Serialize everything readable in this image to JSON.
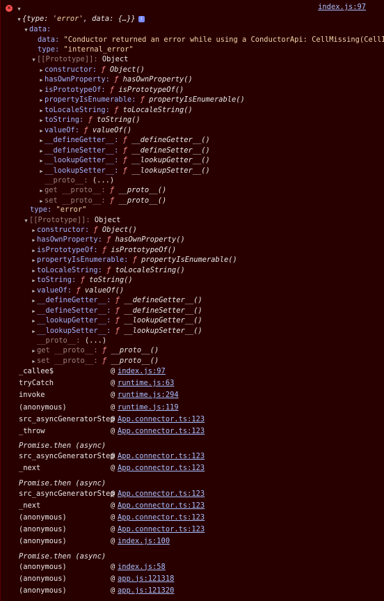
{
  "header": {
    "source_link": "index.js:97",
    "summary_prefix": "{type: ",
    "summary_type_value": "'error'",
    "summary_mid": ", data: ",
    "summary_data_value": "{…}",
    "summary_suffix": "}",
    "info_badge": "i"
  },
  "data_obj": {
    "label": "data:",
    "data_key": "data:",
    "data_value": "\"Conductor returned an error while using a ConductorApi: CellMissing(CellId(",
    "type_key": "type:",
    "type_value": "\"internal_error\"",
    "proto_label": "[[Prototype]]:",
    "proto_value": "Object"
  },
  "proto_members": [
    {
      "key": "constructor:",
      "fn": "Object()"
    },
    {
      "key": "hasOwnProperty:",
      "fn": "hasOwnProperty()"
    },
    {
      "key": "isPrototypeOf:",
      "fn": "isPrototypeOf()"
    },
    {
      "key": "propertyIsEnumerable:",
      "fn": "propertyIsEnumerable()"
    },
    {
      "key": "toLocaleString:",
      "fn": "toLocaleString()"
    },
    {
      "key": "toString:",
      "fn": "toString()"
    },
    {
      "key": "valueOf:",
      "fn": "valueOf()"
    },
    {
      "key": "__defineGetter__:",
      "fn": "__defineGetter__()"
    },
    {
      "key": "__defineSetter__:",
      "fn": "__defineSetter__()"
    },
    {
      "key": "__lookupGetter__:",
      "fn": "__lookupGetter__()"
    },
    {
      "key": "__lookupSetter__:",
      "fn": "__lookupSetter__()"
    }
  ],
  "proto_tail": {
    "proto_key": "__proto__:",
    "proto_value": "(...)",
    "get_key": "get __proto__:",
    "get_fn": "__proto__()",
    "set_key": "set __proto__:",
    "set_fn": "__proto__()"
  },
  "f_glyph": "ƒ",
  "outer": {
    "type_key": "type:",
    "type_value": "\"error\"",
    "proto_label": "[[Prototype]]:",
    "proto_value": "Object"
  },
  "stack": [
    {
      "kind": "frame",
      "name": "_callee$",
      "at": "@",
      "link": "index.js:97"
    },
    {
      "kind": "frame",
      "name": "tryCatch",
      "at": "@",
      "link": "runtime.js:63"
    },
    {
      "kind": "frame",
      "name": "invoke",
      "at": "@",
      "link": "runtime.js:294"
    },
    {
      "kind": "frame",
      "name": "(anonymous)",
      "at": "@",
      "link": "runtime.js:119"
    },
    {
      "kind": "frame",
      "name": "src_asyncGeneratorStep",
      "at": "@",
      "link": "App.connector.ts:123"
    },
    {
      "kind": "frame",
      "name": "_throw",
      "at": "@",
      "link": "App.connector.ts:123"
    },
    {
      "kind": "async",
      "name": "Promise.then (async)"
    },
    {
      "kind": "frame",
      "name": "src_asyncGeneratorStep",
      "at": "@",
      "link": "App.connector.ts:123"
    },
    {
      "kind": "frame",
      "name": "_next",
      "at": "@",
      "link": "App.connector.ts:123"
    },
    {
      "kind": "async",
      "name": "Promise.then (async)"
    },
    {
      "kind": "frame",
      "name": "src_asyncGeneratorStep",
      "at": "@",
      "link": "App.connector.ts:123"
    },
    {
      "kind": "frame",
      "name": "_next",
      "at": "@",
      "link": "App.connector.ts:123"
    },
    {
      "kind": "frame",
      "name": "(anonymous)",
      "at": "@",
      "link": "App.connector.ts:123"
    },
    {
      "kind": "frame",
      "name": "(anonymous)",
      "at": "@",
      "link": "App.connector.ts:123"
    },
    {
      "kind": "frame",
      "name": "(anonymous)",
      "at": "@",
      "link": "index.js:100"
    },
    {
      "kind": "async",
      "name": "Promise.then (async)"
    },
    {
      "kind": "frame",
      "name": "(anonymous)",
      "at": "@",
      "link": "index.js:58"
    },
    {
      "kind": "frame",
      "name": "(anonymous)",
      "at": "@",
      "link": "app.js:121318"
    },
    {
      "kind": "frame",
      "name": "(anonymous)",
      "at": "@",
      "link": "app.js:121320"
    }
  ],
  "colors": {
    "background": "#290000",
    "error_icon": "#ff4f4f",
    "key": "#9fb3ff",
    "string": "#f0d4a8",
    "function_marker": "#ff8a8a",
    "link": "#a8c0ff"
  }
}
